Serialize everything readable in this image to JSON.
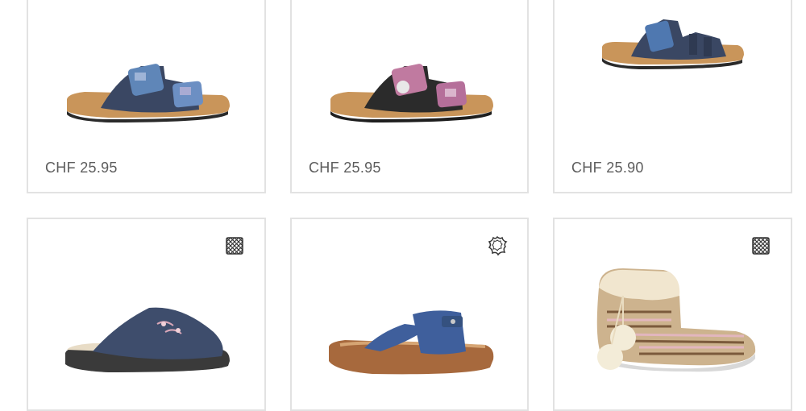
{
  "products": [
    {
      "price": "CHF 25.95",
      "image": "navy-two-strap-cork-sandal-floral-buckles"
    },
    {
      "price": "CHF 25.95",
      "image": "black-two-strap-cork-sandal-pink-floral-buckles"
    },
    {
      "price": "CHF 25.90",
      "image": "navy-multi-strap-cork-sandal"
    },
    {
      "badge_icon": "textile-material-icon",
      "image": "navy-felt-clog-slipper-embroidered"
    },
    {
      "badge_icon": "leather-material-icon",
      "image": "blue-leather-slide-sandal"
    },
    {
      "badge_icon": "textile-material-icon",
      "image": "knit-bootie-slipper-pompoms"
    }
  ],
  "colors": {
    "card_border": "#e2e2e2",
    "price_text": "#5d5d5d"
  }
}
